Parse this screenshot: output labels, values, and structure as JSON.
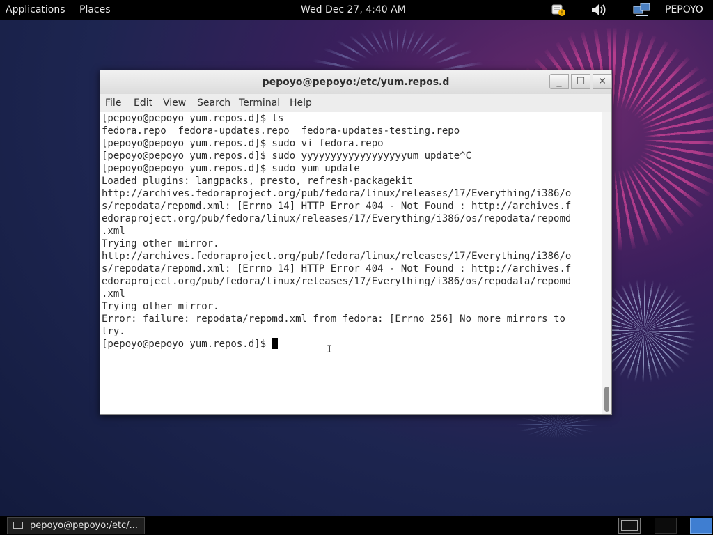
{
  "top_panel": {
    "applications_label": "Applications",
    "places_label": "Places",
    "clock": "Wed Dec 27,  4:40 AM",
    "user_label": "PEPOYO",
    "icons": [
      "notification-icon",
      "volume-icon",
      "network-icon"
    ]
  },
  "window": {
    "title": "pepoyo@pepoyo:/etc/yum.repos.d",
    "buttons": {
      "minimize": "_",
      "maximize": "☐",
      "close": "✕"
    },
    "menu": {
      "file": "File",
      "edit": "Edit",
      "view": "View",
      "search": "Search",
      "terminal": "Terminal",
      "help": "Help"
    }
  },
  "terminal": {
    "output": "[pepoyo@pepoyo yum.repos.d]$ ls\nfedora.repo  fedora-updates.repo  fedora-updates-testing.repo\n[pepoyo@pepoyo yum.repos.d]$ sudo vi fedora.repo\n[pepoyo@pepoyo yum.repos.d]$ sudo yyyyyyyyyyyyyyyyyyum update^C\n[pepoyo@pepoyo yum.repos.d]$ sudo yum update\nLoaded plugins: langpacks, presto, refresh-packagekit\nhttp://archives.fedoraproject.org/pub/fedora/linux/releases/17/Everything/i386/o\ns/repodata/repomd.xml: [Errno 14] HTTP Error 404 - Not Found : http://archives.f\nedoraproject.org/pub/fedora/linux/releases/17/Everything/i386/os/repodata/repomd\n.xml\nTrying other mirror.\nhttp://archives.fedoraproject.org/pub/fedora/linux/releases/17/Everything/i386/o\ns/repodata/repomd.xml: [Errno 14] HTTP Error 404 - Not Found : http://archives.f\nedoraproject.org/pub/fedora/linux/releases/17/Everything/i386/os/repodata/repomd\n.xml\nTrying other mirror.\nError: failure: repodata/repomd.xml from fedora: [Errno 256] No more mirrors to\ntry.\n",
    "prompt": "[pepoyo@pepoyo yum.repos.d]$ "
  },
  "taskbar": {
    "task_label": "pepoyo@pepoyo:/etc/..."
  },
  "colors": {
    "panel": "#000000",
    "desktop": "#1d2550",
    "accent_pink": "#ff50aa",
    "workspace_active": "#3f7ed1"
  }
}
